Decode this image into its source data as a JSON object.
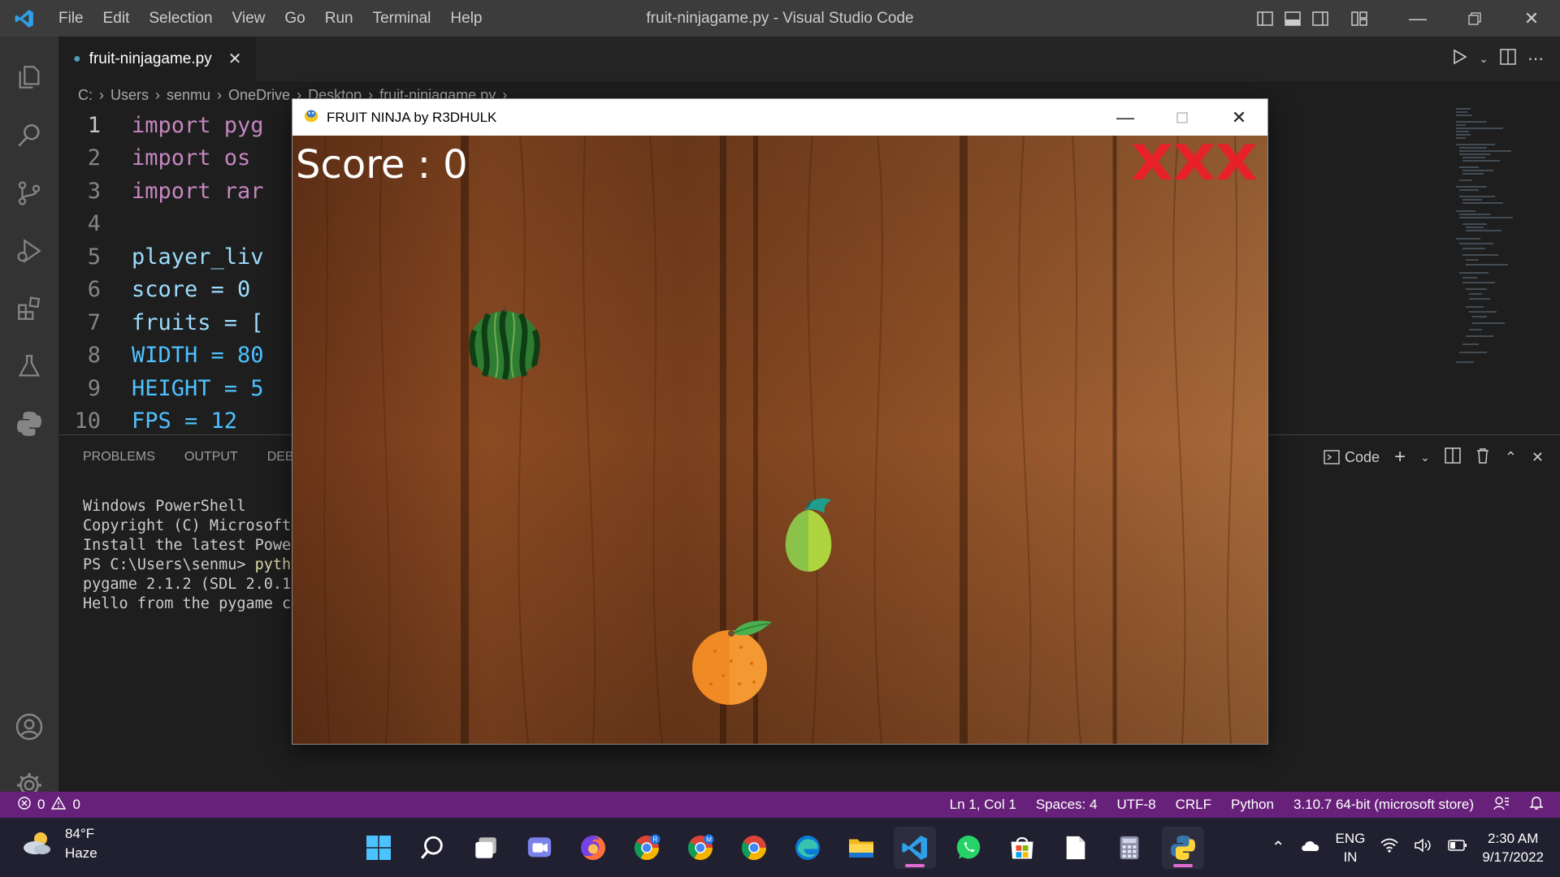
{
  "window": {
    "title": "fruit-ninjagame.py - Visual Studio Code",
    "menu": [
      "File",
      "Edit",
      "Selection",
      "View",
      "Go",
      "Run",
      "Terminal",
      "Help"
    ]
  },
  "editor": {
    "tab_label": "fruit-ninjagame.py",
    "breadcrumb": [
      "C:",
      "Users",
      "senmu",
      "OneDrive",
      "Desktop",
      "fruit-ninjagame.py",
      "..."
    ],
    "lines": [
      {
        "n": "1",
        "text": "import pyg"
      },
      {
        "n": "2",
        "text": "import os"
      },
      {
        "n": "3",
        "text": "import rar"
      },
      {
        "n": "4",
        "text": ""
      },
      {
        "n": "5",
        "text": "player_liv"
      },
      {
        "n": "6",
        "text": "score = 0"
      },
      {
        "n": "7",
        "text": "fruits = ["
      },
      {
        "n": "8",
        "text": "WIDTH = 80"
      },
      {
        "n": "9",
        "text": "HEIGHT = 5"
      },
      {
        "n": "10",
        "text": "FPS = 12"
      }
    ]
  },
  "panel": {
    "tabs": [
      "PROBLEMS",
      "OUTPUT",
      "DEBU"
    ],
    "terminal_profile": "Code",
    "terminal_lines": [
      "Windows PowerShell",
      "Copyright (C) Microsoft",
      "",
      "Install the latest Power",
      "",
      "PS C:\\Users\\senmu> ",
      "pygame 2.1.2 (SDL 2.0.18",
      "Hello from the pygame co"
    ],
    "terminal_cmd": "pytho"
  },
  "statusbar": {
    "errors": "0",
    "warnings": "0",
    "position": "Ln 1, Col 1",
    "spaces": "Spaces: 4",
    "encoding": "UTF-8",
    "eol": "CRLF",
    "language": "Python",
    "interpreter": "3.10.7 64-bit (microsoft store)"
  },
  "game": {
    "title": "FRUIT NINJA by R3DHULK",
    "score_text": "Score : 0",
    "lives_marks": "XXX",
    "lives_color": "#e8202a",
    "fruits": [
      "watermelon",
      "guava",
      "orange"
    ]
  },
  "taskbar": {
    "weather_temp": "84°F",
    "weather_desc": "Haze",
    "lang_top": "ENG",
    "lang_bottom": "IN",
    "time": "2:30 AM",
    "date": "9/17/2022",
    "apps": [
      "start-icon",
      "search-icon",
      "task-view-icon",
      "teams-chat-icon",
      "firefox-icon",
      "chrome-profile-r-icon",
      "chrome-profile-m-icon",
      "chrome-icon",
      "edge-icon",
      "file-explorer-icon",
      "vscode-icon",
      "whatsapp-icon",
      "microsoft-store-icon",
      "notepad-icon",
      "calculator-icon",
      "python-icon"
    ]
  },
  "colors": {
    "statusbar": "#68217a",
    "titlebar": "#3c3c3c",
    "activitybar": "#333333",
    "editor_bg": "#1e1e1e",
    "taskbar": "#202030"
  }
}
